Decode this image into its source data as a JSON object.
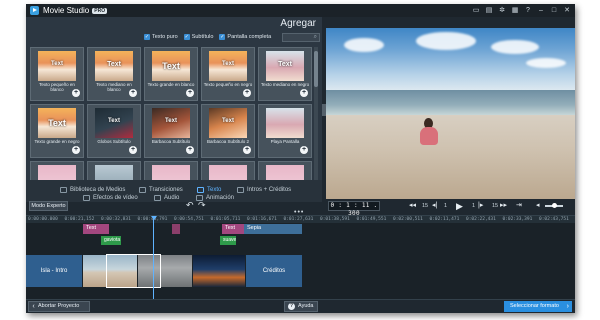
{
  "app": {
    "title": "Movie Studio",
    "edition": "PRO"
  },
  "titlebar_icons": [
    "chat-icon",
    "cart-icon",
    "settings-icon",
    "layout-icon",
    "help-icon",
    "minimize-icon",
    "maximize-icon",
    "close-icon"
  ],
  "titlebar_glyphs": {
    "chat": "▭",
    "cart": "▤",
    "settings": "✲",
    "layout": "▦",
    "help": "?",
    "minimize": "–",
    "maximize": "□",
    "close": "✕"
  },
  "media": {
    "heading": "Agregar",
    "filters": [
      {
        "label": "Texto puro",
        "checked": true
      },
      {
        "label": "Subtítulo",
        "checked": true
      },
      {
        "label": "Pantalla completa",
        "checked": true
      }
    ],
    "search_placeholder": "",
    "tiles": [
      {
        "thumb_text": "Text",
        "caption": "Texto pequeño en blanco",
        "style": "beach"
      },
      {
        "thumb_text": "Text",
        "caption": "Texto mediano en blanco",
        "style": "beach"
      },
      {
        "thumb_text": "Text",
        "caption": "Texto grande en blanco",
        "style": "beach"
      },
      {
        "thumb_text": "Text",
        "caption": "Texto pequeño en negro",
        "style": "beach"
      },
      {
        "thumb_text": "Text",
        "caption": "Texto mediano en negro",
        "style": "sea"
      },
      {
        "thumb_text": "Text",
        "caption": "Texto grande en negro",
        "style": "beach"
      },
      {
        "thumb_text": "Text",
        "caption": "Globos Subtítulo",
        "style": "red"
      },
      {
        "thumb_text": "Text",
        "caption": "Barbacoa Subtítulo",
        "style": "bbq"
      },
      {
        "thumb_text": "Text",
        "caption": "Barbacoa Subtítulo 2",
        "style": "bbq2"
      },
      {
        "thumb_text": "",
        "caption": "Playa Pantalla",
        "style": "sea"
      },
      {
        "thumb_text": "",
        "caption": "",
        "style": "pink"
      },
      {
        "thumb_text": "",
        "caption": "",
        "style": "bike"
      },
      {
        "thumb_text": "",
        "caption": "",
        "style": "pink"
      },
      {
        "thumb_text": "",
        "caption": "",
        "style": "pink"
      },
      {
        "thumb_text": "",
        "caption": "",
        "style": "pink"
      }
    ],
    "plus_glyph": "+"
  },
  "tabs": [
    {
      "label": "Biblioteca de Medios",
      "active": false
    },
    {
      "label": "Transiciones",
      "active": false
    },
    {
      "label": "Texto",
      "active": true
    },
    {
      "label": "Intros + Créditos",
      "active": false
    },
    {
      "label": "Efectos de vídeo",
      "active": false
    },
    {
      "label": "Audio",
      "active": false
    },
    {
      "label": "Animación",
      "active": false
    }
  ],
  "transport": {
    "timecode": "0 : 1 : 11 . 300",
    "skip_back_label": "15",
    "skip_forward_label": "15",
    "frame_back": "1",
    "frame_forward": "1",
    "glyphs": {
      "prev": "◂◂",
      "back_frame": "◂|",
      "play": "▶",
      "fwd_frame": "|▸",
      "next": "▸▸",
      "mark": "⇥",
      "vol": "◂"
    },
    "volume_level": 0.55
  },
  "timeline": {
    "mode_label": "Modo Experto",
    "undo_glyph": "↶",
    "redo_glyph": "↷",
    "more_glyph": "•••",
    "ruler": [
      "0:00:00.000",
      "0:00:21,152",
      "0:00:32,831",
      "0:00:43,791",
      "0:00:54,751",
      "0:01:05,711",
      "0:01:16,671",
      "0:01:27,631",
      "0:01:38,591",
      "0:01:49,551",
      "0:02:00,511",
      "0:02:11,471",
      "0:02:22,431",
      "0:02:33,391",
      "0:02:43,751"
    ],
    "text_clips": [
      "Text",
      "Text"
    ],
    "sepia_label": "Sepia",
    "audio_clips": [
      "gaviota",
      "suave"
    ],
    "video_intro": "Isla - Intro",
    "video_credits": "Créditos"
  },
  "bottom": {
    "back_label": "Abortar Proyecto",
    "back_glyph": "‹",
    "help_label": "Ayuda",
    "help_glyph": "?",
    "next_label": "Seleccionar formato",
    "next_glyph": "›"
  },
  "colors": {
    "accent": "#2a8fe0",
    "text_clip": "#a3477f",
    "audio_clip": "#2e9a4a",
    "sepia_clip": "#3e6f9a",
    "video_title": "#2f5f8f"
  }
}
